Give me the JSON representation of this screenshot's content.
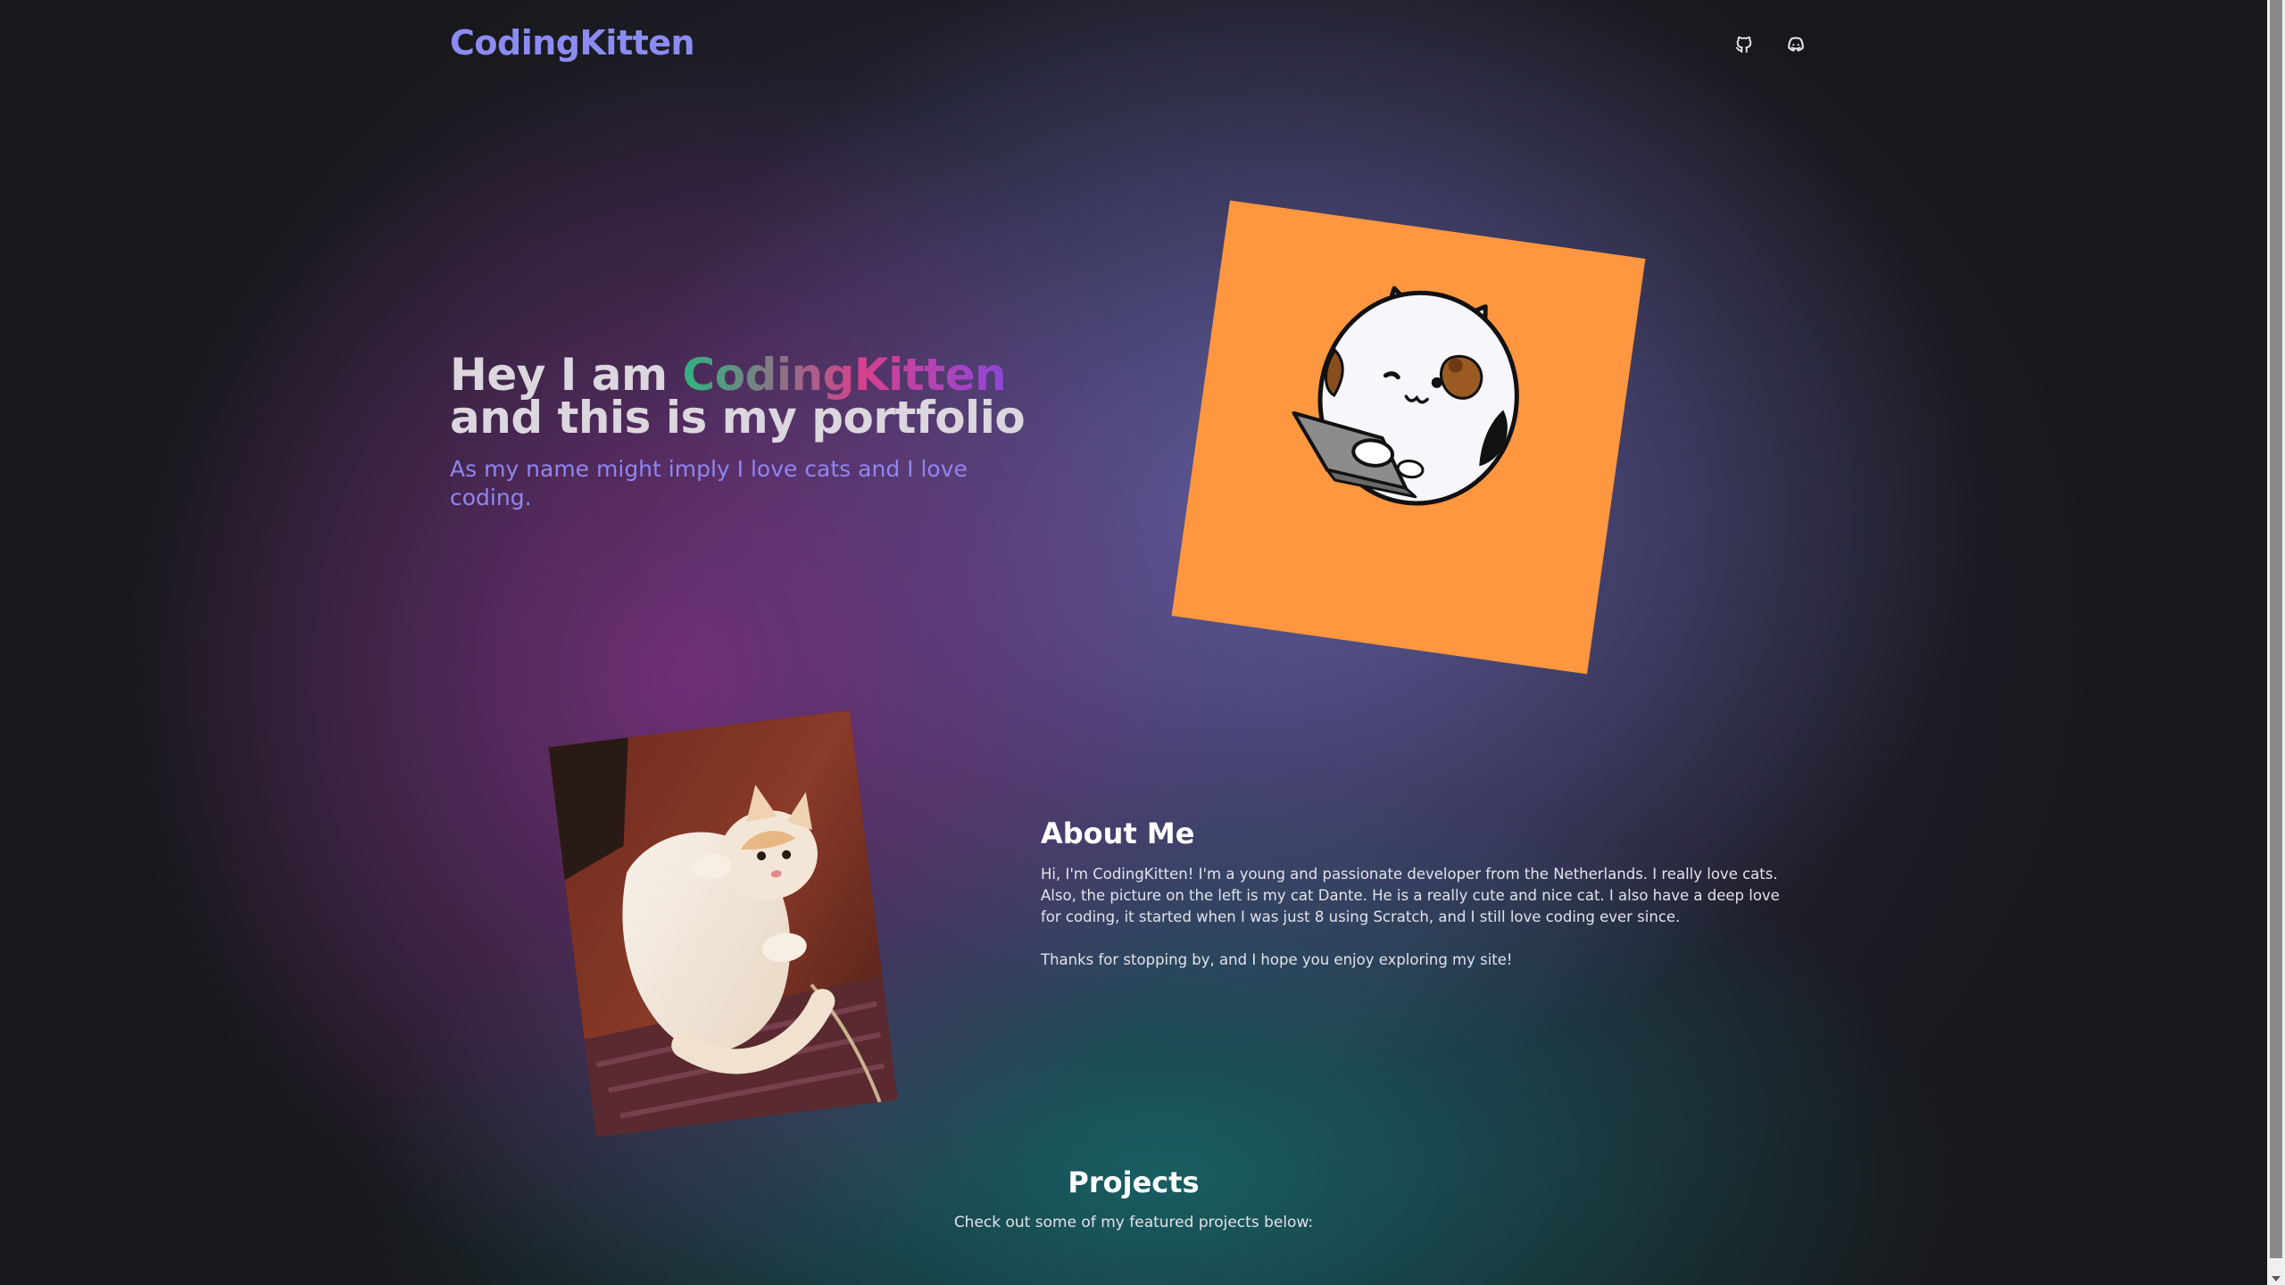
{
  "header": {
    "brand": "CodingKitten",
    "icons": [
      "github-icon",
      "discord-icon"
    ]
  },
  "hero": {
    "title_prefix": "Hey I am ",
    "title_name": "CodingKitten",
    "title_line2": "and this is my portfolio",
    "subtitle": "As my name might imply I love cats and I love coding."
  },
  "about": {
    "title": "About Me",
    "paragraph1": "Hi, I'm CodingKitten! I'm a young and passionate developer from the Netherlands. I really love cats. Also, the picture on the left is my cat Dante. He is a really cute and nice cat. I also have a deep love for coding, it started when I was just 8 using Scratch, and I still love coding ever since.",
    "paragraph2": "Thanks for stopping by, and I hope you enjoy exploring my site!"
  },
  "projects": {
    "title": "Projects",
    "subtitle": "Check out some of my featured projects below:"
  },
  "colors": {
    "brand": "#8b8cf2",
    "kitten_card_bg": "#ff9640",
    "subtitle": "#8f86f0"
  }
}
